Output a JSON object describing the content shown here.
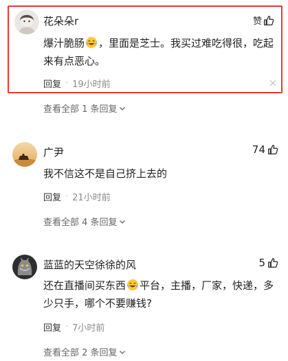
{
  "comments": [
    {
      "username": "花朵朵r",
      "like_label": "赞",
      "text_before": "爆汁脆肠",
      "text_after": "，里面是芝士。我买过难吃得很，吃起来有点恶心。",
      "reply_label": "回复",
      "dot": "·",
      "time": "19小时前",
      "view_all": "查看全部 1 条回复"
    },
    {
      "username": "广尹",
      "like_count": "74",
      "text": "我不信这不是自己挤上去的",
      "reply_label": "回复",
      "dot": "·",
      "time": "21小时前",
      "view_all": "查看全部 4 条回复"
    },
    {
      "username": "蓝蓝的天空徐徐的风",
      "like_count": "5",
      "text_before": "还在直播间买东西",
      "text_after": "平台，主播，厂家，快递，多少只手，哪个不要赚钱?",
      "reply_label": "回复",
      "dot": "·",
      "time": "7小时前",
      "view_all": "查看全部 2 条回复"
    }
  ],
  "icons": {
    "thumb": "thumbs-up-icon",
    "close": "close-icon",
    "chevron": "chevron-down-icon",
    "emoji": "laughing-tears-emoji"
  },
  "colors": {
    "highlight_border": "#e53935",
    "meta_text": "#8a8a8a"
  }
}
